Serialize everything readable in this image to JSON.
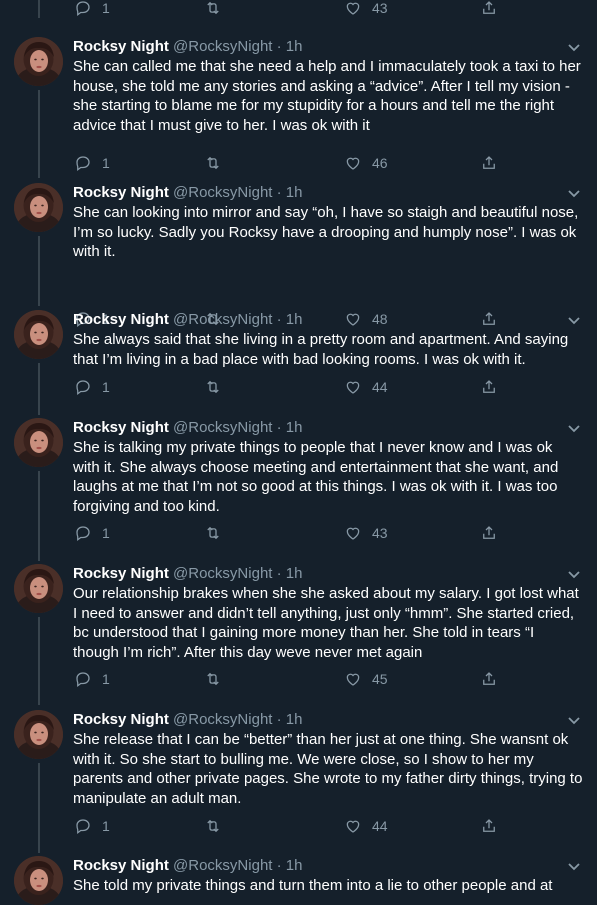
{
  "top_actions": {
    "reply_count": "1",
    "retweet_count": "",
    "like_count": "43"
  },
  "tweets": [
    {
      "name": "Rocksy Night",
      "handle": "@RocksyNight",
      "time": "1h",
      "text": "She can called me that she need a help and I immaculately took a taxi to her house, she told me any stories and asking a “advice”. After I tell my vision - she starting to blame me for my stupidity for a hours and tell me the right advice that I must give to her. I was ok with it",
      "reply_count": "1",
      "like_count": "46"
    },
    {
      "name": "Rocksy Night",
      "handle": "@RocksyNight",
      "time": "1h",
      "text": "She can looking into mirror and say “oh, I have so staigh and beautiful nose, I’m so lucky. Sadly you Rocksy have a drooping and humply nose”. I was ok with it.",
      "reply_count": "1",
      "like_count": "48"
    },
    {
      "name": "Rocksy Night",
      "handle": "@RocksyNight",
      "time": "1h",
      "text": "She always said that she living in a pretty room and apartment. And saying that I’m living in a bad place with bad looking rooms. I was ok with it.",
      "reply_count": "1",
      "like_count": "44"
    },
    {
      "name": "Rocksy Night",
      "handle": "@RocksyNight",
      "time": "1h",
      "text": "She is talking my private things to people that I never know and I was ok with it. She always choose meeting and entertainment that she want, and laughs at me that I’m not so good at this things. I was ok with it. I was too forgiving and too kind.",
      "reply_count": "1",
      "like_count": "43"
    },
    {
      "name": "Rocksy Night",
      "handle": "@RocksyNight",
      "time": "1h",
      "text": "Our relationship brakes when she she asked about my salary. I got lost what I need to answer and didn’t tell anything, just only “hmm”. She started cried, bc understood that I gaining more money than her. She told in tears “I though I’m rich”. After this day weve never met again",
      "reply_count": "1",
      "like_count": "45"
    },
    {
      "name": "Rocksy Night",
      "handle": "@RocksyNight",
      "time": "1h",
      "text": "She release that I can be “better” than her just at one thing. She wansnt ok with it. So she start to bulling me. We were close, so I show to her my parents and other private pages. She wrote to my father dirty things, trying to manipulate an adult man.",
      "reply_count": "1",
      "like_count": "44"
    },
    {
      "name": "Rocksy Night",
      "handle": "@RocksyNight",
      "time": "1h",
      "text": "She told my private things and turn them into a lie to other people and at",
      "reply_count": "",
      "like_count": ""
    }
  ],
  "icons": {
    "reply": "reply-icon",
    "retweet": "retweet-icon",
    "like": "heart-icon",
    "share": "share-icon",
    "more": "chevron-down-icon"
  },
  "colors": {
    "background": "#15202b",
    "muted": "#8899a6",
    "line": "#38444d",
    "text": "#ffffff"
  }
}
